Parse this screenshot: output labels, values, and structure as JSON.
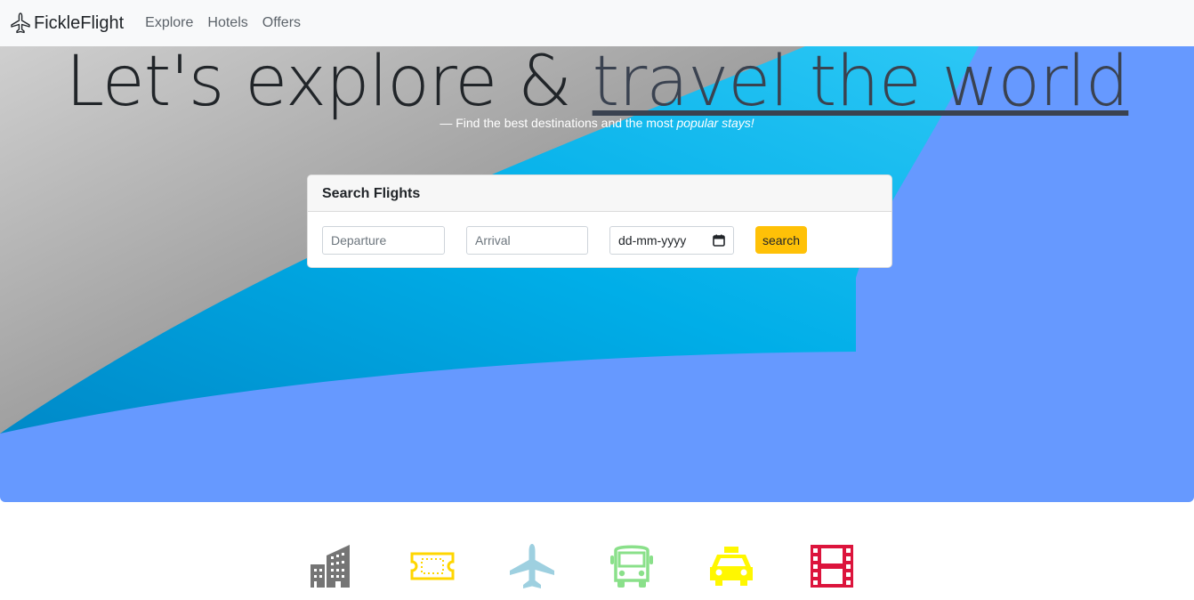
{
  "navbar": {
    "brand": "FickleFlight",
    "links": [
      "Explore",
      "Hotels",
      "Offers"
    ]
  },
  "hero": {
    "headline_prefix": "Let's explore & ",
    "headline_highlight": "travel the world",
    "subtitle_prefix": "— Find the best destinations and the most ",
    "subtitle_emphasis": "popular stays!"
  },
  "search_card": {
    "title": "Search Flights",
    "departure_placeholder": "Departure",
    "arrival_placeholder": "Arrival",
    "date_placeholder": "dd-mm-yyyy",
    "search_label": "search"
  },
  "categories": [
    {
      "icon": "building-icon",
      "color": "#757575"
    },
    {
      "icon": "ticket-icon",
      "color": "#FFD600"
    },
    {
      "icon": "airplane-icon",
      "color": "#9ED0E0"
    },
    {
      "icon": "bus-icon",
      "color": "#8AE08A"
    },
    {
      "icon": "taxi-icon",
      "color": "#FFF700"
    },
    {
      "icon": "film-icon",
      "color": "#DC143C"
    }
  ],
  "colors": {
    "accent": "#ffc107",
    "hero_blue": "#6699FF",
    "hero_cyan": "#00AEEF"
  }
}
